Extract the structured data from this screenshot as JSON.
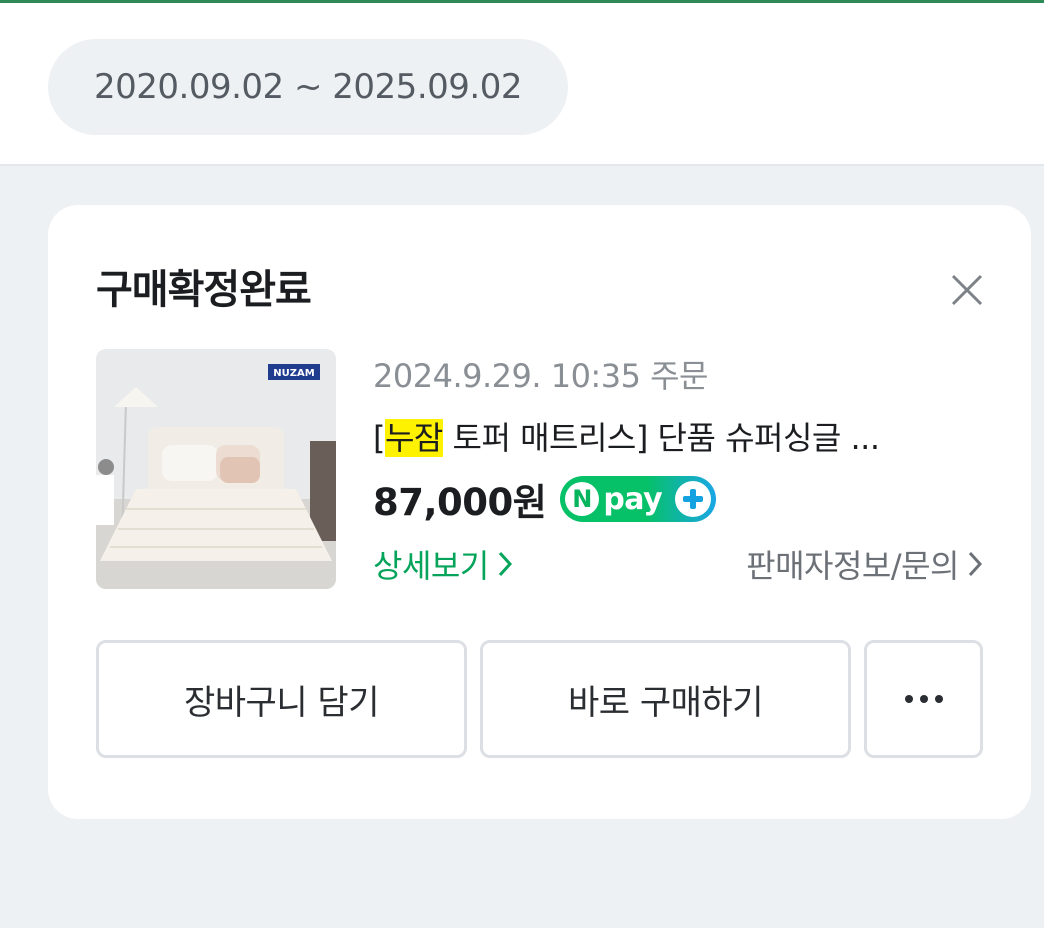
{
  "period": {
    "range_label": "2020.09.02 ~ 2025.09.02"
  },
  "order_card": {
    "status": "구매확정완료",
    "order_date": "2024.9.29. 10:35 주문",
    "product": {
      "brand_highlight": "누잠",
      "title_rest": " 토퍼 매트리스] 단품 슈퍼싱글 ...",
      "thumbnail_logo": "NUZAM",
      "price": "87,000원"
    },
    "npay_badge": {
      "n": "N",
      "text": "pay"
    },
    "links": {
      "detail": "상세보기",
      "seller": "판매자정보/문의"
    },
    "buttons": {
      "cart": "장바구니 담기",
      "buy_now": "바로 구매하기"
    },
    "icons": {
      "close": "close-icon",
      "chevron": "chevron-right-icon",
      "more": "more-dots-icon",
      "npay_plus": "plus-icon"
    }
  },
  "colors": {
    "accent_green": "#05a45a",
    "highlight_yellow": "#fff200",
    "npay_green": "#06c167",
    "npay_blue": "#1aa6e6"
  }
}
